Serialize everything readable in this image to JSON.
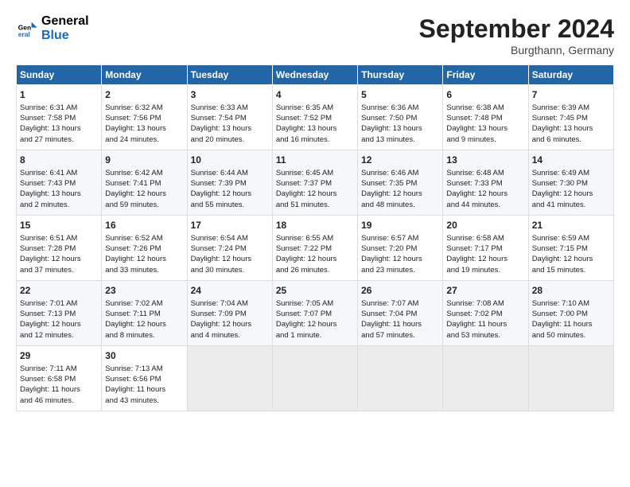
{
  "header": {
    "logo_line1": "General",
    "logo_line2": "Blue",
    "month_title": "September 2024",
    "subtitle": "Burgthann, Germany"
  },
  "weekdays": [
    "Sunday",
    "Monday",
    "Tuesday",
    "Wednesday",
    "Thursday",
    "Friday",
    "Saturday"
  ],
  "weeks": [
    [
      {
        "day": "1",
        "lines": [
          "Sunrise: 6:31 AM",
          "Sunset: 7:58 PM",
          "Daylight: 13 hours",
          "and 27 minutes."
        ]
      },
      {
        "day": "2",
        "lines": [
          "Sunrise: 6:32 AM",
          "Sunset: 7:56 PM",
          "Daylight: 13 hours",
          "and 24 minutes."
        ]
      },
      {
        "day": "3",
        "lines": [
          "Sunrise: 6:33 AM",
          "Sunset: 7:54 PM",
          "Daylight: 13 hours",
          "and 20 minutes."
        ]
      },
      {
        "day": "4",
        "lines": [
          "Sunrise: 6:35 AM",
          "Sunset: 7:52 PM",
          "Daylight: 13 hours",
          "and 16 minutes."
        ]
      },
      {
        "day": "5",
        "lines": [
          "Sunrise: 6:36 AM",
          "Sunset: 7:50 PM",
          "Daylight: 13 hours",
          "and 13 minutes."
        ]
      },
      {
        "day": "6",
        "lines": [
          "Sunrise: 6:38 AM",
          "Sunset: 7:48 PM",
          "Daylight: 13 hours",
          "and 9 minutes."
        ]
      },
      {
        "day": "7",
        "lines": [
          "Sunrise: 6:39 AM",
          "Sunset: 7:45 PM",
          "Daylight: 13 hours",
          "and 6 minutes."
        ]
      }
    ],
    [
      {
        "day": "8",
        "lines": [
          "Sunrise: 6:41 AM",
          "Sunset: 7:43 PM",
          "Daylight: 13 hours",
          "and 2 minutes."
        ]
      },
      {
        "day": "9",
        "lines": [
          "Sunrise: 6:42 AM",
          "Sunset: 7:41 PM",
          "Daylight: 12 hours",
          "and 59 minutes."
        ]
      },
      {
        "day": "10",
        "lines": [
          "Sunrise: 6:44 AM",
          "Sunset: 7:39 PM",
          "Daylight: 12 hours",
          "and 55 minutes."
        ]
      },
      {
        "day": "11",
        "lines": [
          "Sunrise: 6:45 AM",
          "Sunset: 7:37 PM",
          "Daylight: 12 hours",
          "and 51 minutes."
        ]
      },
      {
        "day": "12",
        "lines": [
          "Sunrise: 6:46 AM",
          "Sunset: 7:35 PM",
          "Daylight: 12 hours",
          "and 48 minutes."
        ]
      },
      {
        "day": "13",
        "lines": [
          "Sunrise: 6:48 AM",
          "Sunset: 7:33 PM",
          "Daylight: 12 hours",
          "and 44 minutes."
        ]
      },
      {
        "day": "14",
        "lines": [
          "Sunrise: 6:49 AM",
          "Sunset: 7:30 PM",
          "Daylight: 12 hours",
          "and 41 minutes."
        ]
      }
    ],
    [
      {
        "day": "15",
        "lines": [
          "Sunrise: 6:51 AM",
          "Sunset: 7:28 PM",
          "Daylight: 12 hours",
          "and 37 minutes."
        ]
      },
      {
        "day": "16",
        "lines": [
          "Sunrise: 6:52 AM",
          "Sunset: 7:26 PM",
          "Daylight: 12 hours",
          "and 33 minutes."
        ]
      },
      {
        "day": "17",
        "lines": [
          "Sunrise: 6:54 AM",
          "Sunset: 7:24 PM",
          "Daylight: 12 hours",
          "and 30 minutes."
        ]
      },
      {
        "day": "18",
        "lines": [
          "Sunrise: 6:55 AM",
          "Sunset: 7:22 PM",
          "Daylight: 12 hours",
          "and 26 minutes."
        ]
      },
      {
        "day": "19",
        "lines": [
          "Sunrise: 6:57 AM",
          "Sunset: 7:20 PM",
          "Daylight: 12 hours",
          "and 23 minutes."
        ]
      },
      {
        "day": "20",
        "lines": [
          "Sunrise: 6:58 AM",
          "Sunset: 7:17 PM",
          "Daylight: 12 hours",
          "and 19 minutes."
        ]
      },
      {
        "day": "21",
        "lines": [
          "Sunrise: 6:59 AM",
          "Sunset: 7:15 PM",
          "Daylight: 12 hours",
          "and 15 minutes."
        ]
      }
    ],
    [
      {
        "day": "22",
        "lines": [
          "Sunrise: 7:01 AM",
          "Sunset: 7:13 PM",
          "Daylight: 12 hours",
          "and 12 minutes."
        ]
      },
      {
        "day": "23",
        "lines": [
          "Sunrise: 7:02 AM",
          "Sunset: 7:11 PM",
          "Daylight: 12 hours",
          "and 8 minutes."
        ]
      },
      {
        "day": "24",
        "lines": [
          "Sunrise: 7:04 AM",
          "Sunset: 7:09 PM",
          "Daylight: 12 hours",
          "and 4 minutes."
        ]
      },
      {
        "day": "25",
        "lines": [
          "Sunrise: 7:05 AM",
          "Sunset: 7:07 PM",
          "Daylight: 12 hours",
          "and 1 minute."
        ]
      },
      {
        "day": "26",
        "lines": [
          "Sunrise: 7:07 AM",
          "Sunset: 7:04 PM",
          "Daylight: 11 hours",
          "and 57 minutes."
        ]
      },
      {
        "day": "27",
        "lines": [
          "Sunrise: 7:08 AM",
          "Sunset: 7:02 PM",
          "Daylight: 11 hours",
          "and 53 minutes."
        ]
      },
      {
        "day": "28",
        "lines": [
          "Sunrise: 7:10 AM",
          "Sunset: 7:00 PM",
          "Daylight: 11 hours",
          "and 50 minutes."
        ]
      }
    ],
    [
      {
        "day": "29",
        "lines": [
          "Sunrise: 7:11 AM",
          "Sunset: 6:58 PM",
          "Daylight: 11 hours",
          "and 46 minutes."
        ]
      },
      {
        "day": "30",
        "lines": [
          "Sunrise: 7:13 AM",
          "Sunset: 6:56 PM",
          "Daylight: 11 hours",
          "and 43 minutes."
        ]
      },
      {
        "day": "",
        "lines": []
      },
      {
        "day": "",
        "lines": []
      },
      {
        "day": "",
        "lines": []
      },
      {
        "day": "",
        "lines": []
      },
      {
        "day": "",
        "lines": []
      }
    ]
  ]
}
